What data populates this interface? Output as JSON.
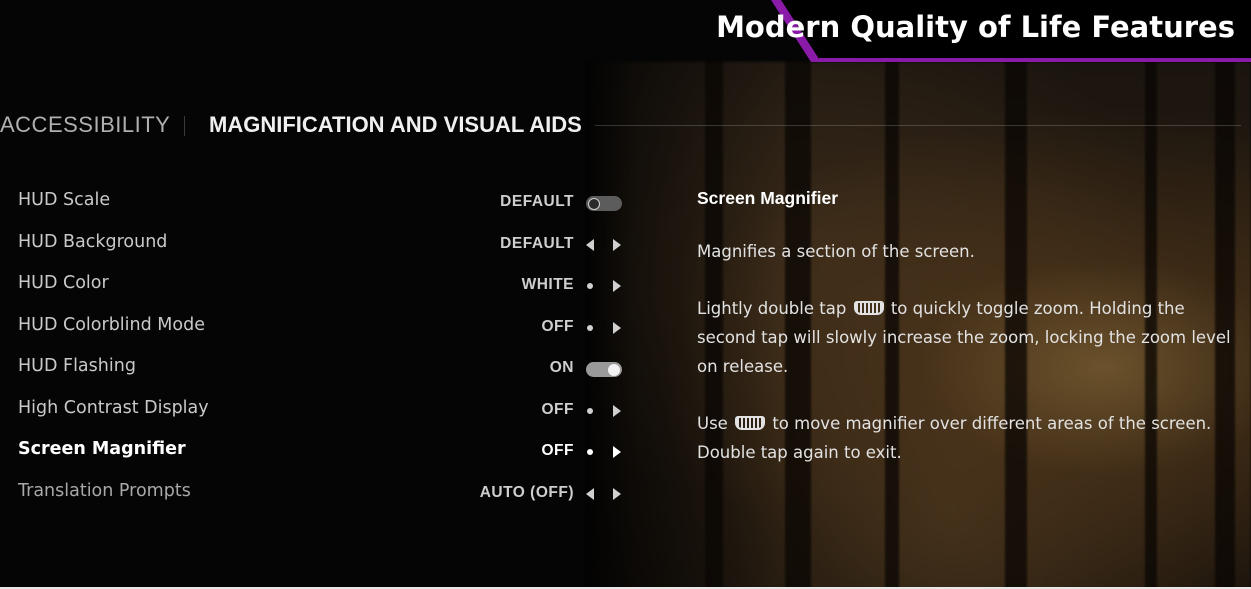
{
  "banner": {
    "text": "Modern Quality of Life Features"
  },
  "header": {
    "parent": "ACCESSIBILITY",
    "section": "MAGNIFICATION AND VISUAL AIDS"
  },
  "settings": [
    {
      "label": "HUD Scale",
      "value": "DEFAULT",
      "control": "toggle",
      "state": "off"
    },
    {
      "label": "HUD Background",
      "value": "DEFAULT",
      "control": "arrows-both"
    },
    {
      "label": "HUD Color",
      "value": "WHITE",
      "control": "dot-arrow"
    },
    {
      "label": "HUD Colorblind Mode",
      "value": "OFF",
      "control": "dot-arrow"
    },
    {
      "label": "HUD Flashing",
      "value": "ON",
      "control": "toggle",
      "state": "on"
    },
    {
      "label": "High Contrast Display",
      "value": "OFF",
      "control": "dot-arrow"
    },
    {
      "label": "Screen Magnifier",
      "value": "OFF",
      "control": "dot-arrow",
      "selected": true
    },
    {
      "label": "Translation Prompts",
      "value": "AUTO (OFF)",
      "control": "arrows-both"
    }
  ],
  "description": {
    "title": "Screen Magnifier",
    "line1": "Magnifies a section of the screen.",
    "p2_before": "Lightly double tap",
    "p2_after": "to quickly toggle zoom. Holding the second tap will slowly increase the zoom, locking the zoom level on release.",
    "p3_before": "Use",
    "p3_after": "to move magnifier over different areas of the screen. Double tap again to exit."
  },
  "colors": {
    "accent": "#8a1aa8",
    "background": "#050505"
  },
  "icons": {
    "touchpad": "touchpad-icon"
  }
}
